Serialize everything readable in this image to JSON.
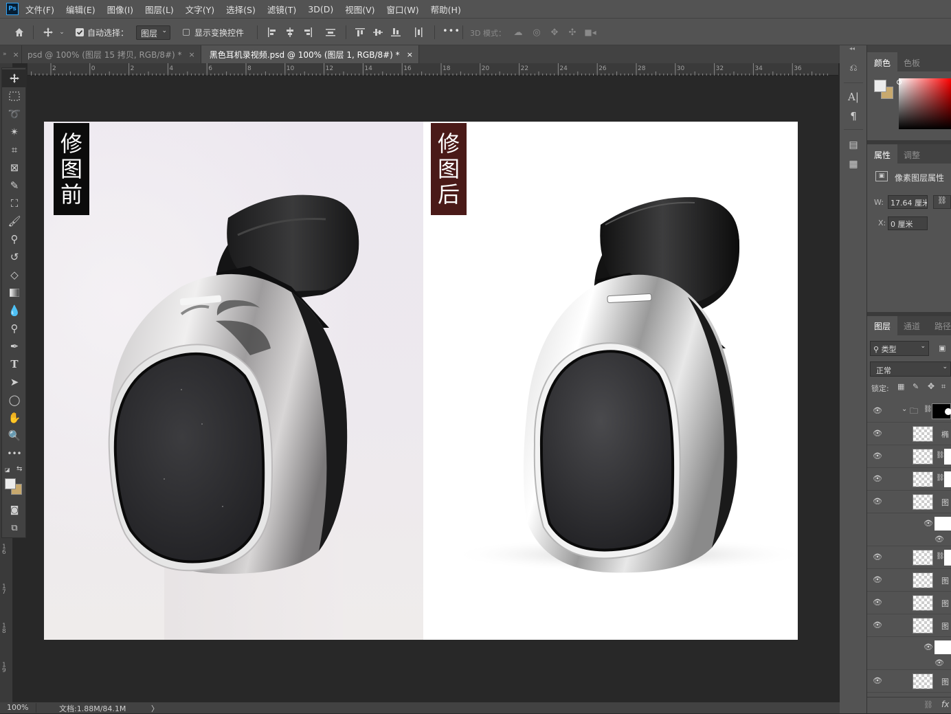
{
  "app": {
    "logo_text": "Ps"
  },
  "menu": [
    "文件(F)",
    "编辑(E)",
    "图像(I)",
    "图层(L)",
    "文字(Y)",
    "选择(S)",
    "滤镜(T)",
    "3D(D)",
    "视图(V)",
    "窗口(W)",
    "帮助(H)"
  ],
  "options": {
    "auto_select_label": "自动选择：",
    "auto_select_checked": true,
    "layer_select_value": "图层",
    "show_transform_label": "显示变换控件",
    "more_label": "•••",
    "mode_3d_label": "3D 模式："
  },
  "tabs": [
    {
      "label": "psd @ 100% (图层 15 拷贝, RGB/8#) *",
      "active": false
    },
    {
      "label": "黑色耳机录视频.psd @ 100% (图层 1, RGB/8#) *",
      "active": true
    }
  ],
  "tab_close": "×",
  "ruler_h": [
    "2",
    "0",
    "2",
    "4",
    "6",
    "8",
    "10",
    "12",
    "14",
    "16",
    "18",
    "20",
    "22",
    "24",
    "26",
    "28",
    "30",
    "32",
    "34",
    "36"
  ],
  "ruler_v": [
    "1\n6",
    "1\n7",
    "1\n8",
    "1\n9"
  ],
  "canvas": {
    "before_label": "修\n图\n前",
    "after_label": "修\n图\n后",
    "before_label_bg": "#0b0b0b",
    "after_label_bg": "#4a1a18"
  },
  "status": {
    "zoom": "100%",
    "doc": "文档:1.88M/84.1M",
    "arrow": "〉"
  },
  "color_panel": {
    "tabs": [
      "颜色",
      "色板"
    ],
    "fg": "#ececec",
    "bg": "#c8a96e"
  },
  "properties_panel": {
    "tabs": [
      "属性",
      "调整"
    ],
    "heading": "像素图层属性",
    "w_label": "W:",
    "w_value": "17.64 厘米",
    "x_label": "X:",
    "x_value": "0 厘米"
  },
  "layers_panel": {
    "tabs": [
      "图层",
      "通道",
      "路径"
    ],
    "filter_value": "类型",
    "blend_mode": "正常",
    "lock_label": "锁定:",
    "rows": [
      "椭",
      "",
      "",
      "图",
      "",
      "图",
      "图",
      "图",
      ""
    ],
    "footer_fx": "fx"
  }
}
